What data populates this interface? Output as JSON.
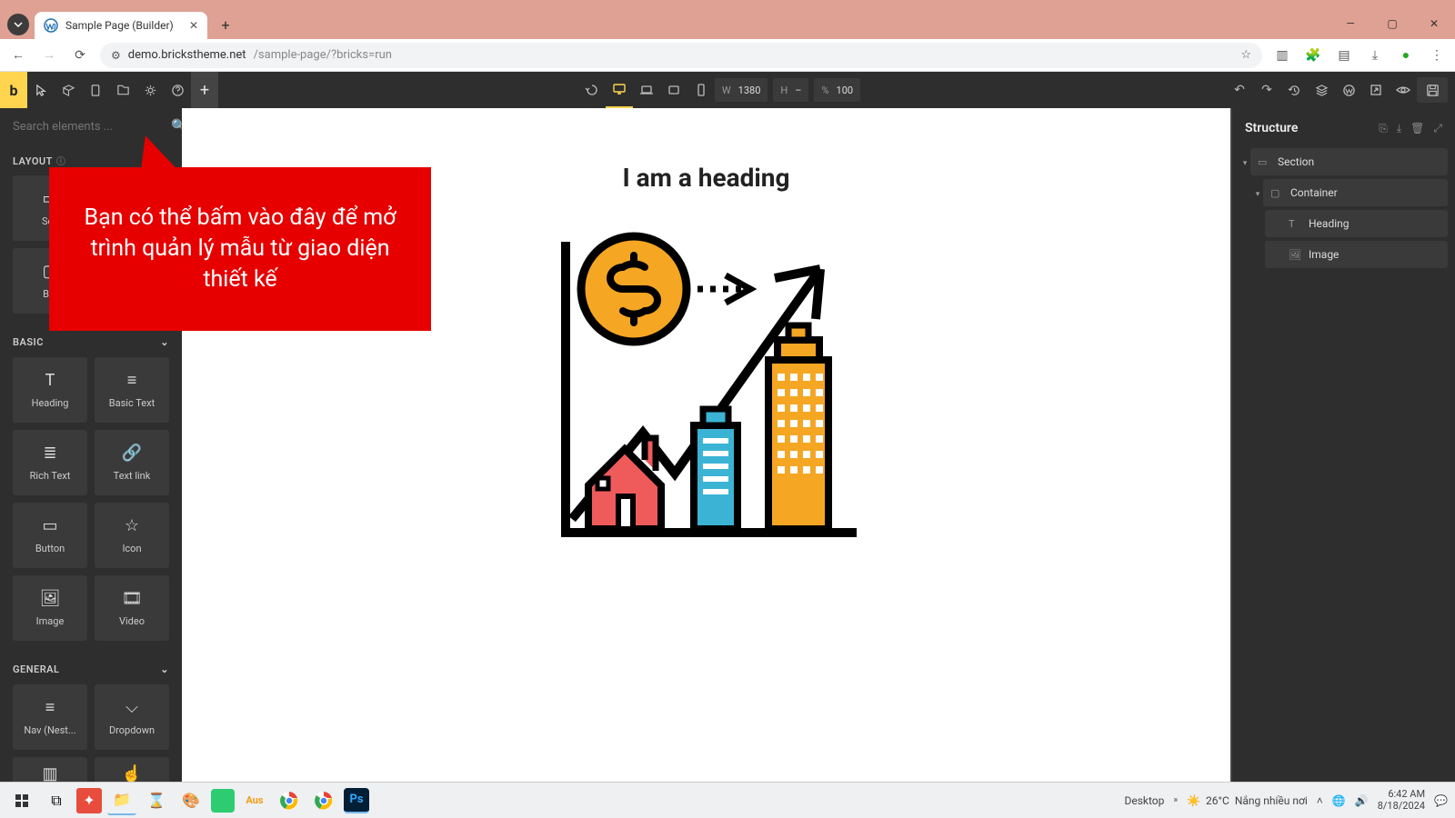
{
  "browser": {
    "tab_title": "Sample Page (Builder)",
    "url_host": "demo.brickstheme.net",
    "url_path": "/sample-page/?bricks=run"
  },
  "toolbar": {
    "width_label": "W",
    "width_value": "1380",
    "height_label": "H",
    "height_value": "–",
    "scale_label": "%",
    "scale_value": "100"
  },
  "left": {
    "search_placeholder": "Search elements ...",
    "cat_layout": "LAYOUT",
    "cat_basic": "BASIC",
    "cat_general": "GENERAL",
    "layout": {
      "section": "Sec",
      "block": "Blo"
    },
    "basic": {
      "heading": "Heading",
      "basic_text": "Basic Text",
      "rich_text": "Rich Text",
      "text_link": "Text link",
      "button": "Button",
      "icon": "Icon",
      "image": "Image",
      "video": "Video"
    },
    "general": {
      "nav": "Nav (Nest...",
      "dropdown": "Dropdown"
    }
  },
  "callout": {
    "text": "Bạn có thể bấm vào đây để mở trình quản lý mẫu từ giao diện thiết kế"
  },
  "page": {
    "heading": "I am a heading"
  },
  "structure": {
    "title": "Structure",
    "section": "Section",
    "container": "Container",
    "heading": "Heading",
    "image": "Image"
  },
  "taskbar": {
    "desktop": "Desktop",
    "temp": "26°C",
    "weather": "Nắng nhiều nơi",
    "time": "6:42 AM",
    "date": "8/18/2024"
  }
}
